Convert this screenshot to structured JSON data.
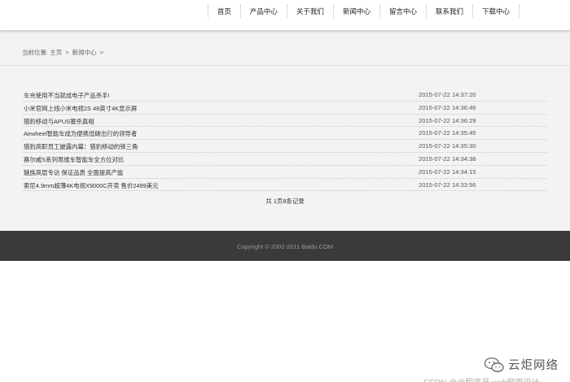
{
  "nav": {
    "items": [
      "首页",
      "产品中心",
      "关于我们",
      "新闻中心",
      "留言中心",
      "联系我们",
      "下载中心"
    ]
  },
  "breadcrumb": {
    "prefix": "当前位置:",
    "home": "主页",
    "separator": ">",
    "current": "新闻中心",
    "trailing": ">"
  },
  "news": [
    {
      "title": "车充使用不当就成电子产品杀手!",
      "date": "2015-07-22 14:37:20"
    },
    {
      "title": "小米官网上线小米电视2S 48英寸4K显示屏",
      "date": "2015-07-22 14:36:46"
    },
    {
      "title": "猎豹移动与APUS塞杀真相",
      "date": "2015-07-22 14:36:29"
    },
    {
      "title": "Airwheel智能车成为便携低碳出行的领导者",
      "date": "2015-07-22 14:35:45"
    },
    {
      "title": "猎豹高职员工披露内幕：猎豹移动的铁三角",
      "date": "2015-07-22 14:35:30"
    },
    {
      "title": "赛尔威S系列思维车智能车全方位对比",
      "date": "2015-07-22 14:34:38"
    },
    {
      "title": "魅族高层专访 保证品质 全面提高产能",
      "date": "2015-07-22 14:34:15"
    },
    {
      "title": "索尼4.9mm超薄4K电视X9000C开卖 售价2499美元",
      "date": "2015-07-22 14:33:56"
    }
  ],
  "pager": {
    "text": "共 1页8条记录"
  },
  "footer": {
    "copyright": "Copyright © 2002-2011 Baidu.COM"
  },
  "watermark": {
    "icon": "wechat-icon",
    "text": "云炬网络",
    "csdn": "CSDN @@程序员 web网页设计"
  }
}
